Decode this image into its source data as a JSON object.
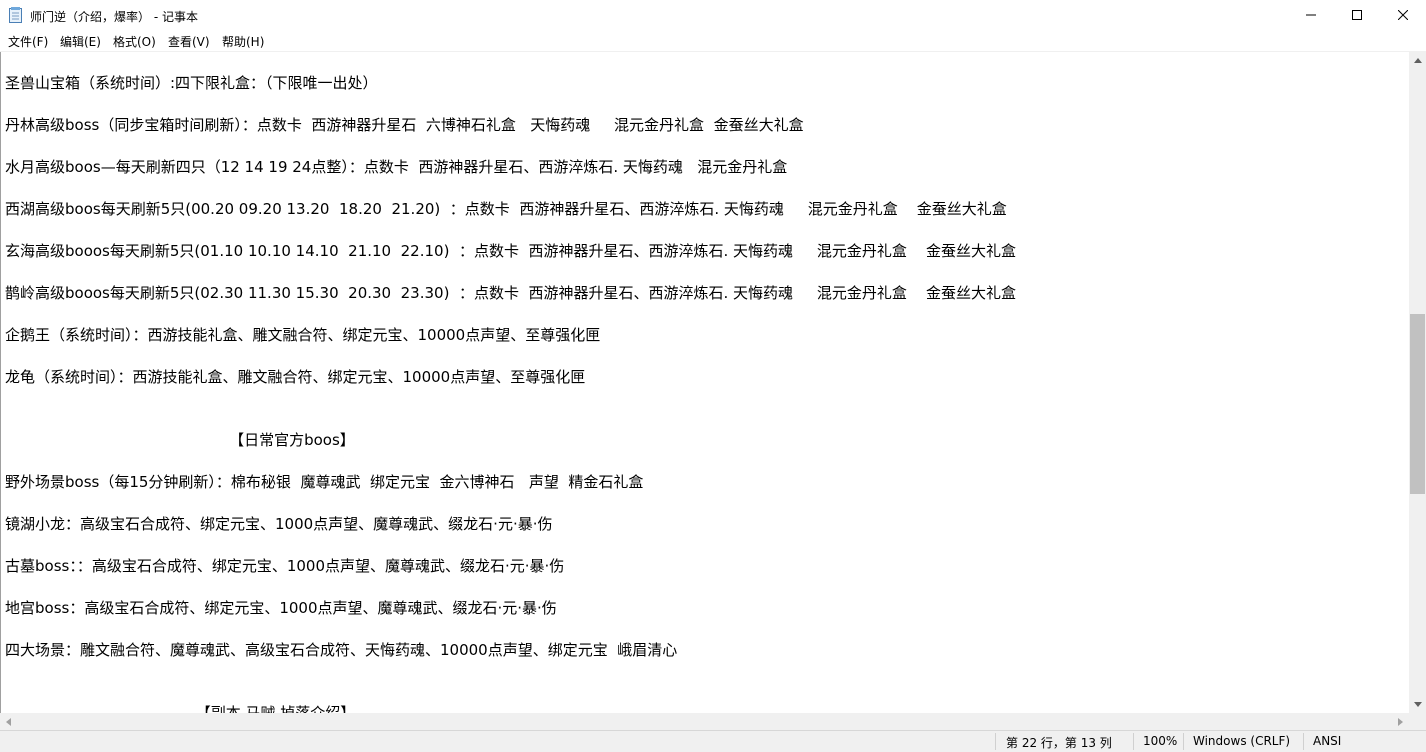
{
  "window": {
    "title": "师门逆（介绍，爆率） - 记事本"
  },
  "menu": {
    "items": [
      {
        "label": "文件(F)"
      },
      {
        "label": "编辑(E)"
      },
      {
        "label": "格式(O)"
      },
      {
        "label": "查看(V)"
      },
      {
        "label": "帮助(H)"
      }
    ]
  },
  "document": {
    "lines": [
      "圣兽山宝箱（系统时间）:四下限礼盒：（下限唯一出处）",
      "丹林高级boss（同步宝箱时间刷新）：点数卡  西游神器升星石  六博神石礼盒   天悔药魂     混元金丹礼盒  金蚕丝大礼盒",
      "水月高级boos—每天刷新四只（12 14 19 24点整）：点数卡  西游神器升星石、西游淬炼石. 天悔药魂   混元金丹礼盒",
      "西湖高级boos每天刷新5只(00.20 09.20 13.20  18.20  21.20)  ：点数卡  西游神器升星石、西游淬炼石. 天悔药魂     混元金丹礼盒    金蚕丝大礼盒",
      "玄海高级booos每天刷新5只(01.10 10.10 14.10  21.10  22.10)  ：点数卡  西游神器升星石、西游淬炼石. 天悔药魂     混元金丹礼盒    金蚕丝大礼盒",
      "鹊岭高级booos每天刷新5只(02.30 11.30 15.30  20.30  23.30)  ：点数卡  西游神器升星石、西游淬炼石. 天悔药魂     混元金丹礼盒    金蚕丝大礼盒",
      "企鹅王（系统时间）：西游技能礼盒、雕文融合符、绑定元宝、10000点声望、至尊强化匣",
      "龙龟（系统时间）：西游技能礼盒、雕文融合符、绑定元宝、10000点声望、至尊强化匣",
      "                                               【日常官方boos】",
      "野外场景boss（每15分钟刷新）：棉布秘银  魔尊魂武  绑定元宝  金六博神石   声望  精金石礼盒",
      "镜湖小龙：高级宝石合成符、绑定元宝、1000点声望、魔尊魂武、缀龙石·元·暴·伤",
      "古墓boss：：高级宝石合成符、绑定元宝、1000点声望、魔尊魂武、缀龙石·元·暴·伤",
      "地宫boss：高级宝石合成符、绑定元宝、1000点声望、魔尊魂武、缀龙石·元·暴·伤",
      "四大场景：雕文融合符、魔尊魂武、高级宝石合成符、天悔药魂、10000点声望、绑定元宝  峨眉清心",
      "                                        【副本 马贼 掉落介绍】"
    ]
  },
  "status": {
    "position": "第 22 行，第 13 列",
    "zoom": "100%",
    "line_ending": "Windows (CRLF)",
    "encoding": "ANSI"
  }
}
